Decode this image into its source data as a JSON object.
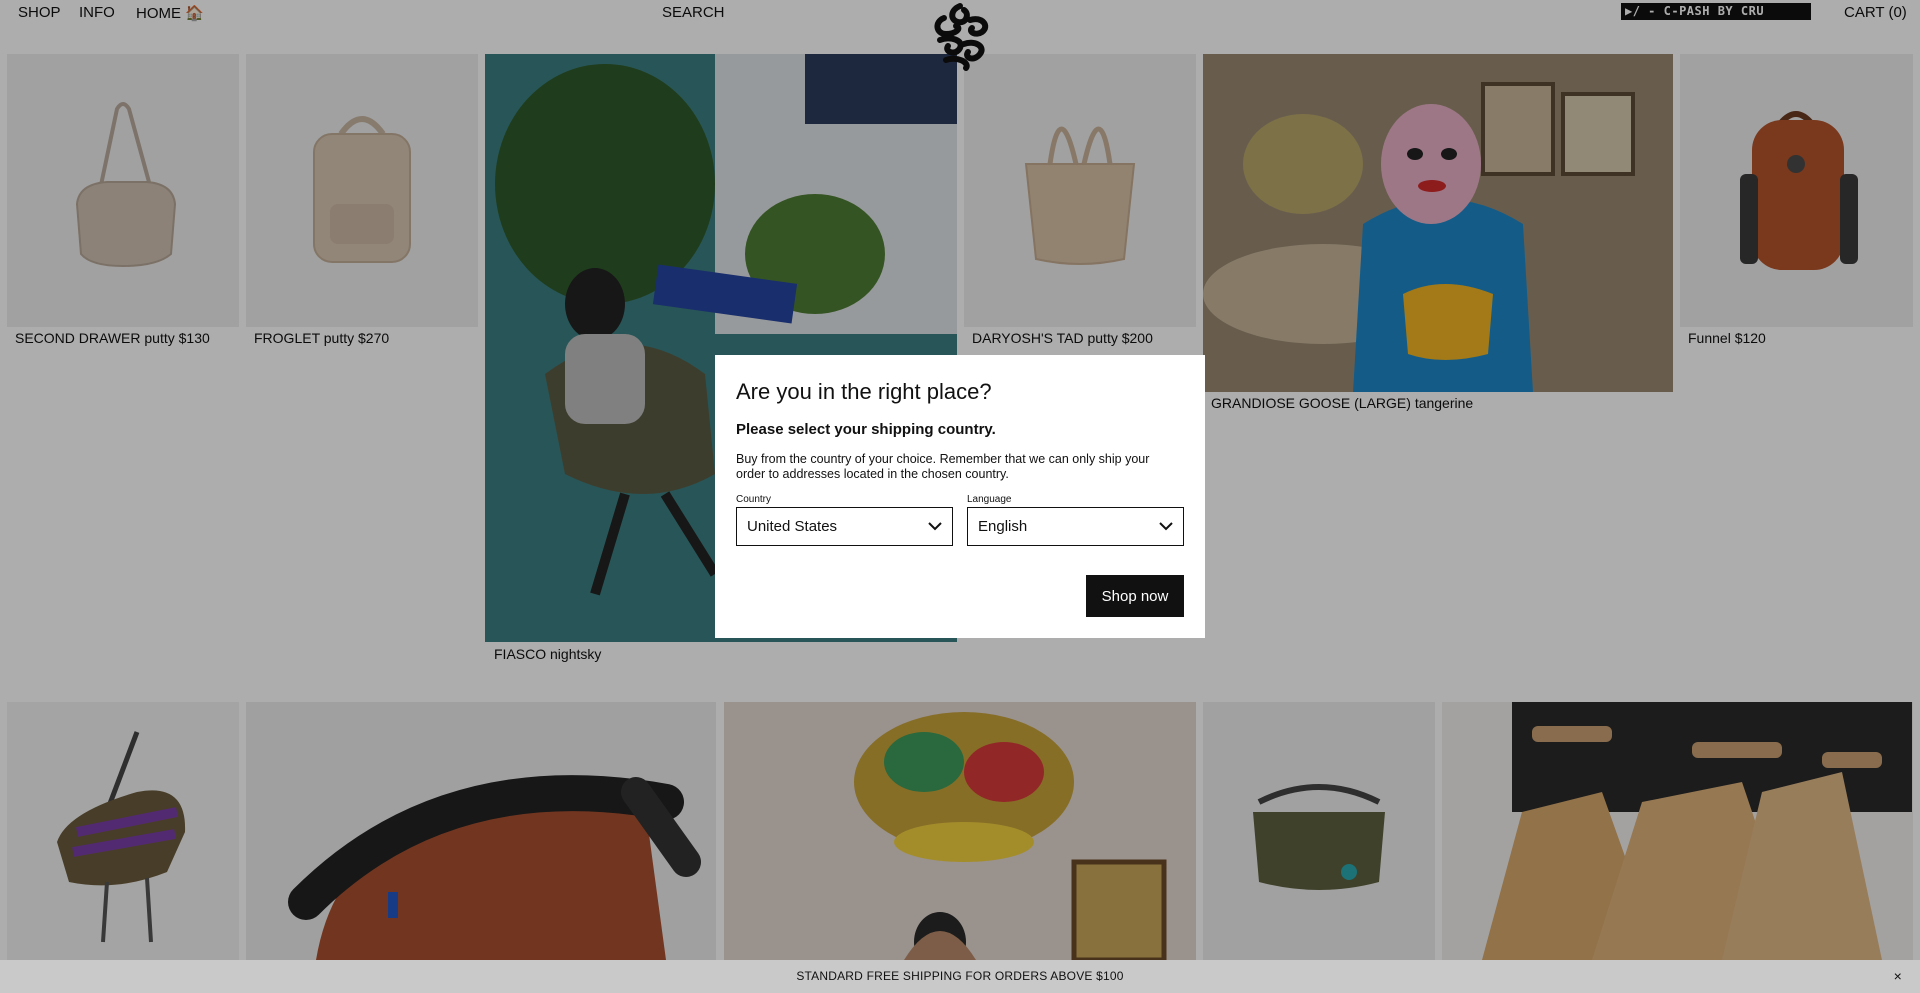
{
  "header": {
    "nav": {
      "shop": "SHOP",
      "info": "INFO",
      "home": "HOME 🏠",
      "search": "SEARCH",
      "cart": "CART (0)"
    },
    "ticker": "▶/ - C-PASH BY CRU"
  },
  "products_row1": [
    {
      "caption": "SECOND DRAWER putty $130"
    },
    {
      "caption": "FROGLET putty $270"
    },
    {
      "caption": "FIASCO nightsky"
    },
    {
      "caption": "DARYOSH'S TAD putty $200"
    },
    {
      "caption": "GRANDIOSE GOOSE (LARGE) tangerine"
    },
    {
      "caption": "Funnel $120"
    }
  ],
  "modal": {
    "title": "Are you in the right place?",
    "subtitle": "Please select your shipping country.",
    "body": "Buy from the country of your choice. Remember that we can only ship your order to addresses located in the chosen country.",
    "country_label": "Country",
    "country_value": "United States",
    "language_label": "Language",
    "language_value": "English",
    "cta": "Shop now"
  },
  "banner": {
    "text": "STANDARD FREE SHIPPING FOR ORDERS ABOVE $100",
    "close": "×"
  },
  "colors": {
    "accent": "#111111",
    "overlay": "rgba(0,0,0,0.32)",
    "banner_bg": "#c9c9c9"
  }
}
